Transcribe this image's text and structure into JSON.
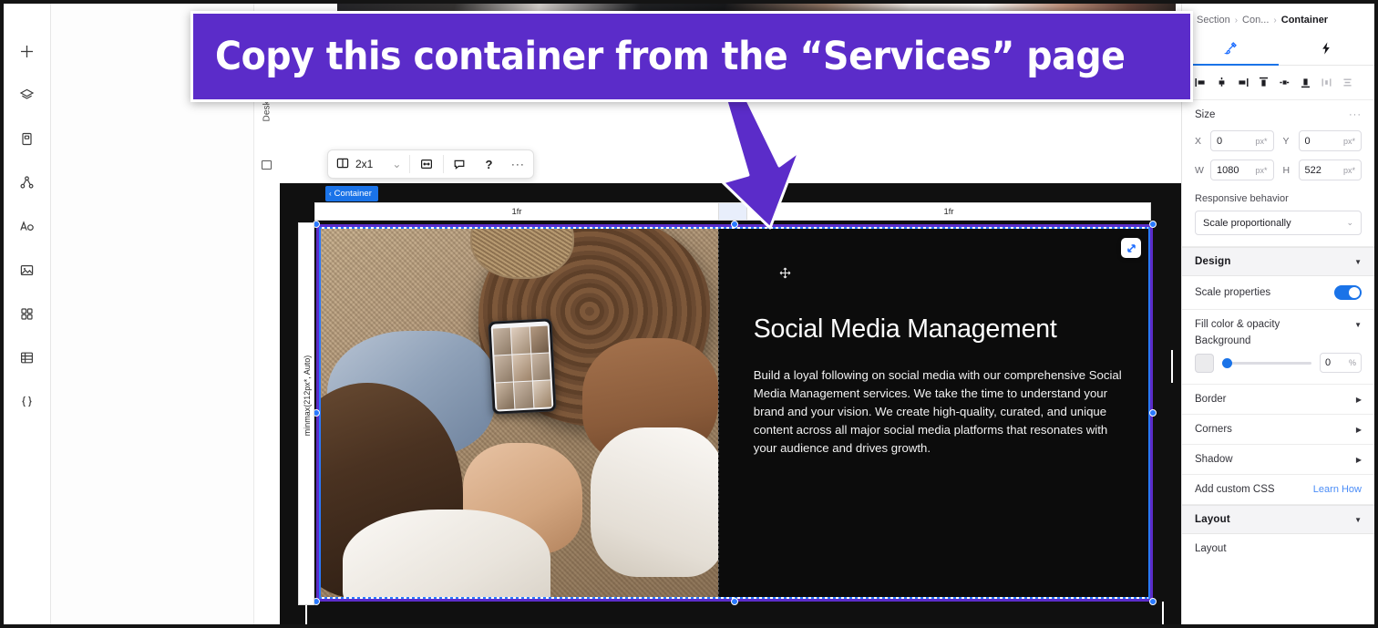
{
  "annotation": {
    "banner_text": "Copy this container from the “Services” page",
    "banner_color": "#5b2cc9",
    "arrow_color": "#5b2cc9"
  },
  "left_rail": {
    "items": [
      {
        "name": "add-icon",
        "label": "Add"
      },
      {
        "name": "layers-icon",
        "label": "Layers"
      },
      {
        "name": "page-icon",
        "label": "Pages"
      },
      {
        "name": "sitemap-icon",
        "label": "Site structure"
      },
      {
        "name": "text-icon",
        "label": "Text"
      },
      {
        "name": "image-icon",
        "label": "Media"
      },
      {
        "name": "apps-icon",
        "label": "Apps"
      },
      {
        "name": "table-icon",
        "label": "Table"
      },
      {
        "name": "code-icon",
        "label": "Custom code"
      }
    ]
  },
  "canvas": {
    "breakpoint_label": "Desktop (Prim",
    "toolbar": {
      "ratio_label": "2x1",
      "chevron": "⌄",
      "icons": [
        "distribute-icon",
        "comment-icon",
        "help-icon",
        "more-icon"
      ],
      "help_label": "?",
      "more_label": "···"
    },
    "container_badge": "Container",
    "grid": {
      "columns": [
        "1fr",
        "1fr"
      ],
      "row_label": "minmax(212px*, Auto)"
    },
    "selection": {
      "heading": "Social Media Management",
      "body": "Build a loyal following on social media with our comprehensive Social Media Management services. We take the time to understand your brand and your vision. We create high-quality, curated, and unique content across all major social media platforms that resonates with your audience and drives growth.",
      "outline_color": "#5b2cc9",
      "handle_color": "#2979ff",
      "expand_icon": "expand-icon",
      "move_cursor": "move-cursor-icon"
    }
  },
  "right_panel": {
    "breadcrumb": {
      "root": "Section",
      "middle": "Con...",
      "current": "Container",
      "separator": "›"
    },
    "tabs": [
      {
        "name": "design-tab",
        "icon": "brush-icon",
        "active": true
      },
      {
        "name": "interactions-tab",
        "icon": "lightning-icon",
        "active": false
      }
    ],
    "align_buttons": [
      "align-left-icon",
      "align-center-horizontal-icon",
      "align-right-icon",
      "align-top-icon",
      "align-center-vertical-icon",
      "align-bottom-icon",
      "distribute-horizontal-icon",
      "distribute-vertical-icon"
    ],
    "size": {
      "title": "Size",
      "more": "···",
      "x": {
        "label": "X",
        "value": "0",
        "unit": "px*"
      },
      "y": {
        "label": "Y",
        "value": "0",
        "unit": "px*"
      },
      "w": {
        "label": "W",
        "value": "1080",
        "unit": "px*"
      },
      "h": {
        "label": "H",
        "value": "522",
        "unit": "px*"
      }
    },
    "responsive": {
      "label": "Responsive behavior",
      "value": "Scale proportionally"
    },
    "design": {
      "band_title": "Design",
      "caret": "▼",
      "scale_properties": {
        "label": "Scale properties",
        "enabled": true
      },
      "fill": {
        "label": "Fill color & opacity",
        "caret": "▼",
        "background_label": "Background",
        "opacity_value": "0",
        "opacity_unit": "%",
        "swatch_color": "#ebebed"
      },
      "rows": [
        {
          "label": "Border",
          "caret": "▶"
        },
        {
          "label": "Corners",
          "caret": "▶"
        },
        {
          "label": "Shadow",
          "caret": "▶"
        }
      ],
      "custom_css": {
        "label": "Add custom CSS",
        "link": "Learn How"
      }
    },
    "layout": {
      "band_title": "Layout",
      "caret": "▼",
      "row_label": "Layout"
    }
  }
}
